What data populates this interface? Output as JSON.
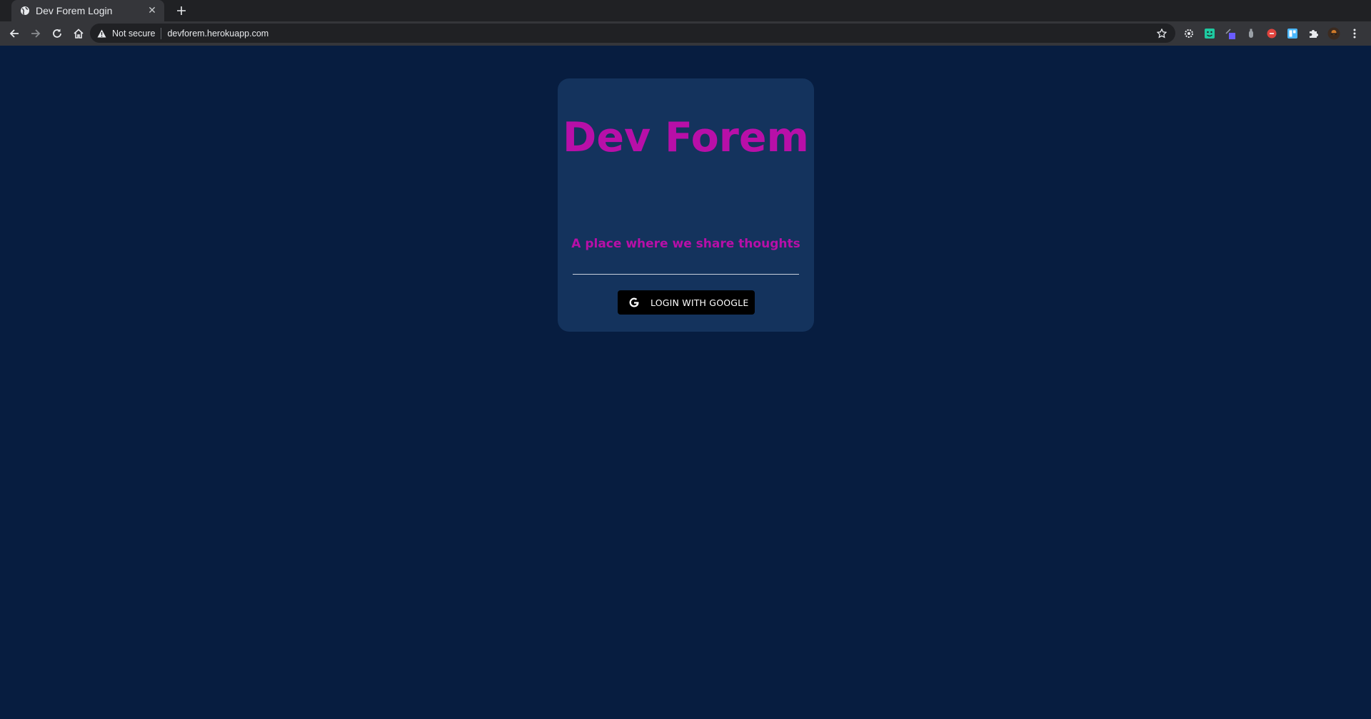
{
  "browser": {
    "tab": {
      "title": "Dev Forem Login",
      "favicon": "globe-icon",
      "close_glyph": "✕"
    },
    "new_tab_icon": "plus-icon",
    "nav": {
      "back_icon": "arrow-left-icon",
      "forward_icon": "arrow-right-icon",
      "reload_icon": "reload-icon",
      "home_icon": "home-icon"
    },
    "omnibox": {
      "security_label": "Not secure",
      "url": "devforem.herokuapp.com",
      "bookmark_icon": "star-icon"
    },
    "extensions": [
      {
        "name": "gear-extension-icon",
        "color": "#e8eaed"
      },
      {
        "name": "green-face-extension-icon",
        "color": "#1ec9a0"
      },
      {
        "name": "purple-square-extension-icon",
        "color": "#6a5cff"
      },
      {
        "name": "gray-bottle-extension-icon",
        "color": "#9aa0a6"
      },
      {
        "name": "red-circle-extension-icon",
        "color": "#e0443e"
      },
      {
        "name": "blue-box-extension-icon",
        "color": "#4ab7ff"
      },
      {
        "name": "puzzle-icon",
        "color": "#e8eaed"
      },
      {
        "name": "profile-avatar",
        "color": "#d07a2a"
      },
      {
        "name": "kebab-menu-icon",
        "color": "#e8eaed"
      }
    ]
  },
  "login_card": {
    "title": "Dev Forem",
    "subtitle": "A place where we share thoughts",
    "login_button_label": "LOGIN WITH GOOGLE",
    "login_button_icon": "google-icon"
  },
  "colors": {
    "page_background": "#071d40",
    "card_background": "#14335d",
    "accent_magenta": "#b80fa8",
    "button_background": "#000000"
  }
}
